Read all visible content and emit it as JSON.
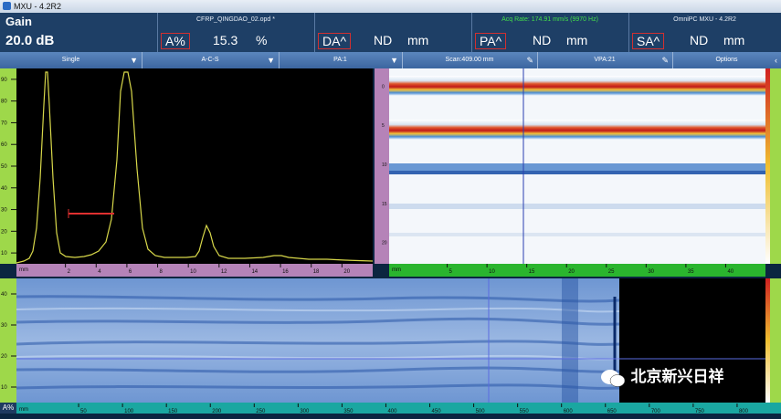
{
  "title_bar": {
    "title": "MXU - 4.2R2"
  },
  "header": {
    "gain_label": "Gain",
    "gain_value": "20.0 dB",
    "file_name": "CFRP_QINGDAO_02.opd *",
    "acq_rate": "Acq Rate: 174.91 mm/s (9970 Hz)",
    "product": "OmniPC MXU - 4.2R2",
    "readings": [
      {
        "label": "A%",
        "value": "15.3",
        "unit": "%"
      },
      {
        "label": "DA^",
        "value": "ND",
        "unit": "mm"
      },
      {
        "label": "PA^",
        "value": "ND",
        "unit": "mm"
      },
      {
        "label": "SA^",
        "value": "ND",
        "unit": "mm"
      }
    ]
  },
  "toolbar": {
    "items": [
      {
        "label": "Single",
        "icon": "arrow-down-icon"
      },
      {
        "label": "A-C-S",
        "icon": "arrow-down-icon"
      },
      {
        "label": "PA:1",
        "icon": "arrow-down-icon"
      },
      {
        "label": "Scan:409.00 mm",
        "icon": "pencil-icon"
      },
      {
        "label": "VPA:21",
        "icon": "pencil-icon"
      },
      {
        "label": "Options",
        "icon": "chevron-left-icon"
      }
    ]
  },
  "ascan": {
    "unit": "mm",
    "x_ticks": [
      "2",
      "4",
      "6",
      "8",
      "10",
      "12",
      "14",
      "16",
      "18",
      "20"
    ],
    "y_ticks": [
      "90",
      "80",
      "70",
      "60",
      "50",
      "40",
      "30",
      "20",
      "10"
    ],
    "trace_color": "#d8d84a",
    "gate_color": "#e03030"
  },
  "cscan": {
    "unit": "mm",
    "x_ticks": [
      "5",
      "10",
      "15",
      "20",
      "25",
      "30",
      "35",
      "40"
    ],
    "y_ticks": [
      "0",
      "5",
      "10",
      "15",
      "20"
    ]
  },
  "bscan": {
    "unit": "mm",
    "x_ticks": [
      "50",
      "100",
      "150",
      "200",
      "250",
      "300",
      "350",
      "400",
      "450",
      "500",
      "550",
      "600",
      "650",
      "700",
      "750",
      "800"
    ],
    "y_ticks": [
      "40",
      "30",
      "20",
      "10"
    ],
    "corner_label": "A%"
  },
  "brand": {
    "text": "北京新兴日祥"
  }
}
